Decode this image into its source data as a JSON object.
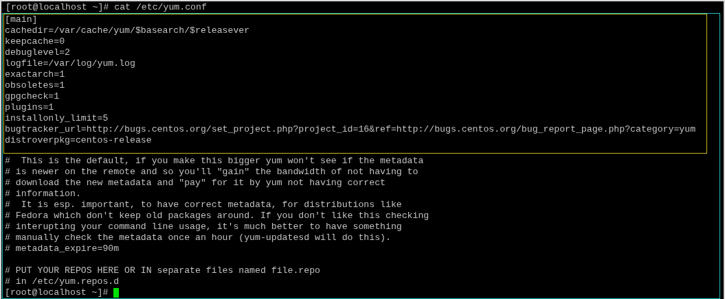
{
  "command": {
    "prompt": "[root@localhost ~]#",
    "text": "cat /etc/yum.conf"
  },
  "config_lines": [
    "[main]",
    "cachedir=/var/cache/yum/$basearch/$releasever",
    "keepcache=0",
    "debuglevel=2",
    "logfile=/var/log/yum.log",
    "exactarch=1",
    "obsoletes=1",
    "gpgcheck=1",
    "plugins=1",
    "installonly_limit=5",
    "bugtracker_url=http://bugs.centos.org/set_project.php?project_id=16&ref=http://bugs.centos.org/bug_report_page.php?category=yum",
    "distroverpkg=centos-release"
  ],
  "comment_blocks": [
    [
      "#  This is the default, if you make this bigger yum won't see if the metadata",
      "# is newer on the remote and so you'll \"gain\" the bandwidth of not having to",
      "# download the new metadata and \"pay\" for it by yum not having correct",
      "# information.",
      "#  It is esp. important, to have correct metadata, for distributions like",
      "# Fedora which don't keep old packages around. If you don't like this checking",
      "# interupting your command line usage, it's much better to have something",
      "# manually check the metadata once an hour (yum-updatesd will do this).",
      "# metadata_expire=90m"
    ],
    [
      "# PUT YOUR REPOS HERE OR IN separate files named file.repo",
      "# in /etc/yum.repos.d"
    ]
  ],
  "final_prompt": "[root@localhost ~]#"
}
